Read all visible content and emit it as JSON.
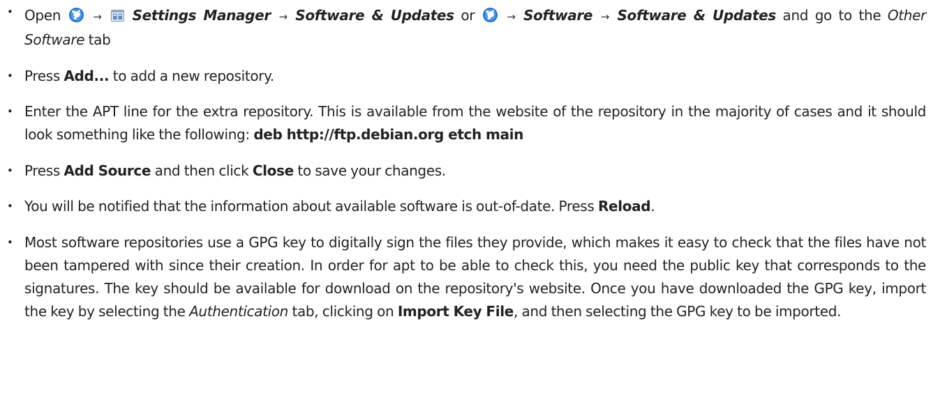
{
  "bullet_glyph": "•",
  "arrow_glyph": "→",
  "icons": {
    "menu": "application-menu-logo-icon",
    "settings": "settings-manager-icon"
  },
  "steps": [
    {
      "open_prefix": "Open",
      "path1_a": "Settings Manager",
      "path1_b": "Software & Updates",
      "or_text": "or",
      "path2_a": "Software",
      "path2_b": "Software & Updates",
      "suffix": "and go to the",
      "tab_name": "Other Software",
      "tab_word": "tab"
    },
    {
      "pre": "Press",
      "button": "Add...",
      "post": "to add a new repository."
    },
    {
      "text": "Enter the APT line for the extra repository. This is available from the website of the repository in the majority of cases and it should look something like the following:",
      "apt_line": "deb http://ftp.debian.org etch main"
    },
    {
      "pre": "Press",
      "button1": "Add Source",
      "mid": "and then click",
      "button2": "Close",
      "post": "to save your changes."
    },
    {
      "text": "You will be notified that the information about available software is out-of-date. Press",
      "button": "Reload",
      "post": "."
    },
    {
      "text": "Most software repositories use a GPG key to digitally sign the files they provide, which makes it easy to check that the files have not been tampered with since their creation. In order for apt to be able to check this, you need the public key that corresponds to the signatures. The key should be available for download on the repository's website. Once you have downloaded the GPG key, import the key by selecting the",
      "tab_name": "Authentication",
      "mid": "tab, clicking on",
      "button": "Import Key File",
      "post": ", and then selecting the GPG key to be imported."
    }
  ]
}
